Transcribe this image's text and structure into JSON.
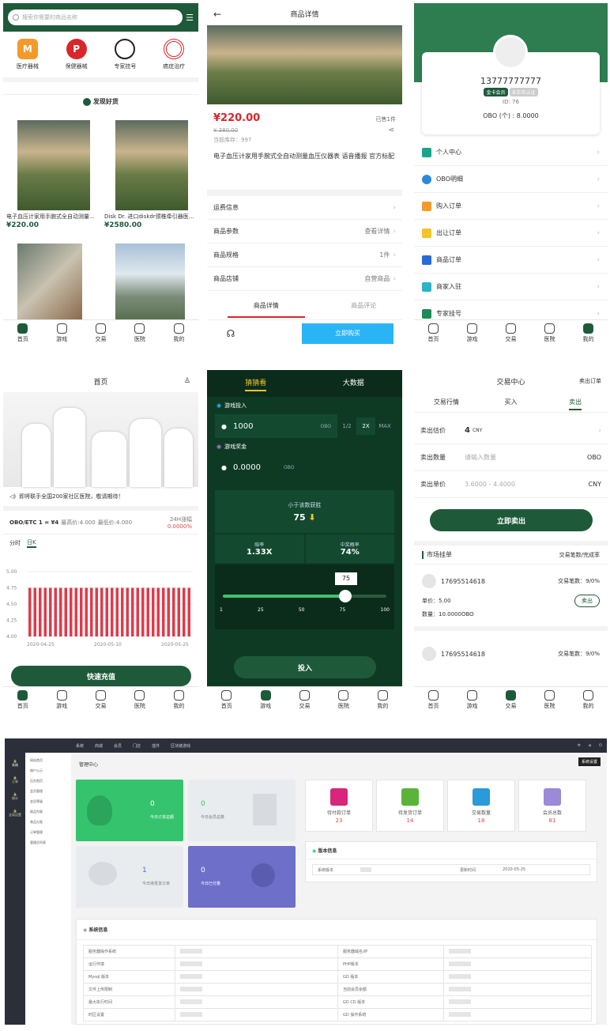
{
  "shop": {
    "search_placeholder": "搜索你需要的商品名称",
    "categories": [
      "医疗器械",
      "保健器械",
      "专家挂号",
      "癌症治疗"
    ],
    "section_title": "发现好货",
    "products": [
      {
        "name": "电子血压计家用手腕式全自动测量…",
        "price": "¥220.00"
      },
      {
        "name": "Disk Dr. 进口diskdr颈椎牵引器医…",
        "price": "¥2580.00"
      }
    ]
  },
  "tabs": [
    "首页",
    "游戏",
    "交易",
    "医院",
    "我的"
  ],
  "detail": {
    "title": "商品详情",
    "price": "¥220.00",
    "sold": "已售1件",
    "old_price": "¥ 380.00",
    "stock": "当前库存：997",
    "name": "电子血压计家用手腕式全自动测量血压仪器表 语音播报 官方标配",
    "rows": [
      {
        "label": "运费信息",
        "value": ""
      },
      {
        "label": "商品参数",
        "value": "查看详情"
      },
      {
        "label": "商品规格",
        "value": "1件"
      },
      {
        "label": "商品店铺",
        "value": "自营商品"
      }
    ],
    "tab_detail": "商品详情",
    "tab_review": "商品评论",
    "buy": "立即购买"
  },
  "profile": {
    "phone": "13777777777",
    "badge_gold": "金卡会员",
    "badge_unverified": "未实名认证",
    "id": "ID: 76",
    "obo": "OBO (个) : 8.0000",
    "menu": [
      "个人中心",
      "OBO明细",
      "购入订单",
      "出让订单",
      "商品订单",
      "商家入驻",
      "专家挂号"
    ]
  },
  "home": {
    "title": "首页",
    "notice": "即将联手全国200家社区医院，敬请期待！",
    "pair": "OBO/ETC 1 = ¥4",
    "high": "最高价:4.000",
    "low": "最低价:4.000",
    "change_label": "24H涨幅",
    "change_value": "0.0000%",
    "tab_min": "分时",
    "tab_day": "日K",
    "yticks": [
      "5.00",
      "4.75",
      "4.50",
      "4.25",
      "4.00"
    ],
    "xticks": [
      "2020-04-25",
      "2020-05-10",
      "2020-05-25"
    ],
    "recharge": "快速充值"
  },
  "game": {
    "tab_guess": "猜猜看",
    "tab_data": "大数据",
    "bet_label": "游戏投入",
    "bet_value": "1000",
    "unit": "OBO",
    "half": "1/2",
    "double": "2X",
    "max": "MAX",
    "prize_label": "游戏奖金",
    "prize_value": "0.0000",
    "under_label": "小于该数获胜",
    "under_value": "75",
    "odds_label": "赔率",
    "odds_value": "1.33X",
    "prob_label": "中奖概率",
    "prob_value": "74%",
    "slider_value": "75",
    "slider_ticks": [
      "1",
      "25",
      "50",
      "75",
      "100"
    ],
    "submit": "投入"
  },
  "trade": {
    "title": "交易中心",
    "sell_orders": "卖出订单",
    "tabs": [
      "交易行情",
      "买入",
      "卖出"
    ],
    "est_label": "卖出估价",
    "est_value": "4",
    "est_unit": "CNY",
    "qty_label": "卖出数量",
    "qty_placeholder": "请输入数量",
    "qty_unit": "OBO",
    "price_label": "卖出单价",
    "price_range": "3.6000 - 4.4000",
    "price_unit": "CNY",
    "sell_btn": "立即卖出",
    "market": "市场挂单",
    "market_stats": "交易笔数/完成率",
    "listings": [
      {
        "user": "17695514618",
        "stats": "交易笔数：9/0%",
        "unit_price": "单价：5.00",
        "qty": "数量：10.0000OBO",
        "btn": "卖出"
      },
      {
        "user": "17695514618",
        "stats": "交易笔数：9/0%"
      }
    ]
  },
  "admin": {
    "topnav": [
      "系统",
      "商城",
      "会员",
      "门店",
      "插件",
      "区块链游戏"
    ],
    "tooltip": "系统设置",
    "sidebar_icons": [
      "系统",
      "订单",
      "统计",
      "全局设置"
    ],
    "sidebar_menu": [
      "网站首页",
      "商户公示",
      "后台首页",
      "会员管理",
      "会员等级",
      "商品列表",
      "商品分类",
      "订单管理",
      "管理员列表"
    ],
    "crumb": "管理中心",
    "cards": [
      {
        "value": "0",
        "label": "今日订单总额"
      },
      {
        "value": "0",
        "label": "今日会员总数"
      },
      {
        "value": "1",
        "label": "今日待发货订单"
      },
      {
        "value": "0",
        "label": "今日已付量"
      }
    ],
    "stats": [
      {
        "label": "待付款订单",
        "value": "23"
      },
      {
        "label": "待发货订单",
        "value": "14"
      },
      {
        "label": "交易数量",
        "value": "18"
      },
      {
        "label": "会员总数",
        "value": "81"
      }
    ],
    "version_title": "版本信息",
    "version_label": "系统版本",
    "version_date_label": "更新时间",
    "version_date": "2020-05-25",
    "sysinfo_title": "系统信息",
    "sys_left": [
      "服务器操作系统",
      "运行环境",
      "Mysql 版本",
      "文件上传限制",
      "最大执行时间",
      "时区设置"
    ],
    "sys_right": [
      "服务器域名/IP",
      "PHP版本",
      "GD 版本",
      "当前会员余额",
      "GD CD 版本",
      "GD 操作系统"
    ]
  }
}
